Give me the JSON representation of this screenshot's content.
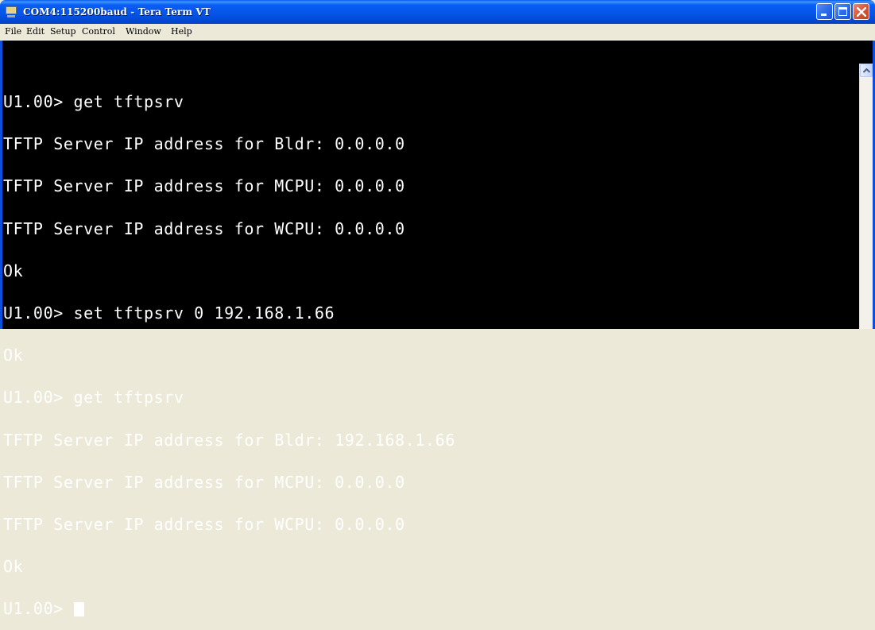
{
  "window": {
    "title": "COM4:115200baud - Tera Term VT"
  },
  "menu": {
    "items": [
      "File",
      "Edit",
      "Setup",
      "Control",
      "Window",
      "Help"
    ]
  },
  "terminal": {
    "lines": [
      "U1.00> get tftpsrv",
      "TFTP Server IP address for Bldr: 0.0.0.0",
      "TFTP Server IP address for MCPU: 0.0.0.0",
      "TFTP Server IP address for WCPU: 0.0.0.0",
      "Ok",
      "U1.00> set tftpsrv 0 192.168.1.66",
      "Ok",
      "U1.00> get tftpsrv",
      "TFTP Server IP address for Bldr: 192.168.1.66",
      "TFTP Server IP address for MCPU: 0.0.0.0",
      "TFTP Server IP address for WCPU: 0.0.0.0",
      "Ok",
      "U1.00> "
    ],
    "background": "#000000",
    "foreground": "#FFFFFF"
  },
  "icons": {
    "app": "terminal-app-icon",
    "minimize": "minimize-icon",
    "maximize": "maximize-icon",
    "close": "close-icon",
    "scroll_up": "scroll-up-arrow-icon"
  }
}
